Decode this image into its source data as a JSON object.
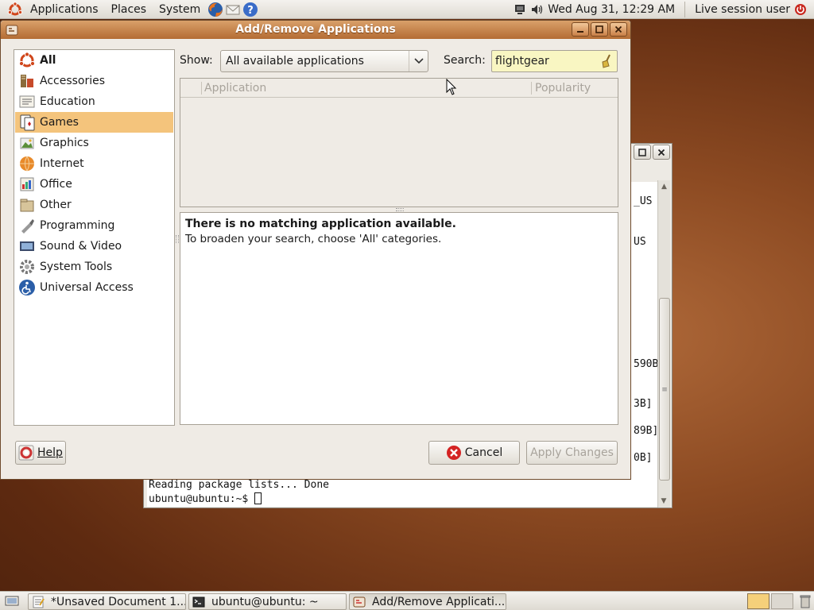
{
  "top_panel": {
    "menus": [
      "Applications",
      "Places",
      "System"
    ],
    "datetime": "Wed Aug 31, 12:29 AM",
    "user": "Live session user"
  },
  "terminal": {
    "fragments": [
      "_US",
      "US",
      "590B",
      "3B]",
      "89B]",
      "0B]"
    ],
    "line1": "Reading package lists... Done",
    "prompt": "ubuntu@ubuntu:~$ "
  },
  "window": {
    "title": "Add/Remove Applications",
    "categories": [
      {
        "label": "All",
        "icon": "ubuntu-logo-icon"
      },
      {
        "label": "Accessories",
        "icon": "accessories-icon"
      },
      {
        "label": "Education",
        "icon": "education-icon"
      },
      {
        "label": "Games",
        "icon": "games-icon"
      },
      {
        "label": "Graphics",
        "icon": "graphics-icon"
      },
      {
        "label": "Internet",
        "icon": "internet-icon"
      },
      {
        "label": "Office",
        "icon": "office-icon"
      },
      {
        "label": "Other",
        "icon": "other-icon"
      },
      {
        "label": "Programming",
        "icon": "programming-icon"
      },
      {
        "label": "Sound & Video",
        "icon": "sound-video-icon"
      },
      {
        "label": "System Tools",
        "icon": "system-tools-icon"
      },
      {
        "label": "Universal Access",
        "icon": "universal-access-icon"
      }
    ],
    "selected_category": "Games",
    "show_label": "Show:",
    "show_value": "All available applications",
    "search_label": "Search:",
    "search_value": "flightgear",
    "columns": [
      "Application",
      "Popularity"
    ],
    "empty_title": "There is no matching application available.",
    "empty_hint": "To broaden your search, choose 'All' categories.",
    "help_label": "Help",
    "cancel_label": "Cancel",
    "apply_label": "Apply Changes"
  },
  "taskbar": {
    "tasks": [
      "*Unsaved Document 1...",
      "ubuntu@ubuntu: ~",
      "Add/Remove Applicati..."
    ]
  },
  "colors": {
    "selection": "#f4c47c",
    "titlebar": "#c9854a",
    "search_bg": "#f9f6c2"
  }
}
